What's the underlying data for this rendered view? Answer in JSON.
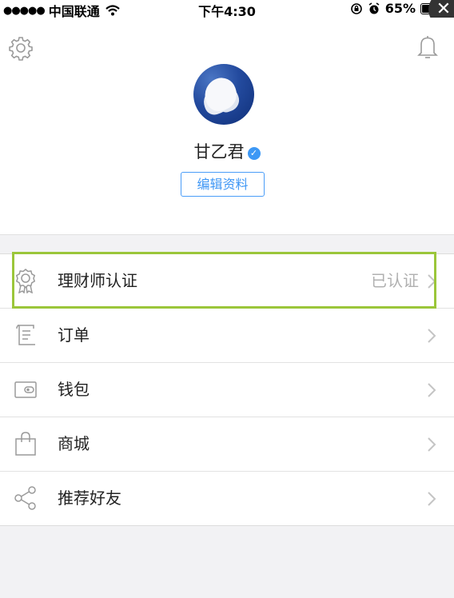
{
  "status_bar": {
    "signal_dots": "●●●●●",
    "carrier": "中国联通",
    "time": "下午4:30",
    "battery": "65%",
    "battery_level": 0.65,
    "close_glyph": "✕"
  },
  "profile": {
    "name": "甘乙君",
    "edit_label": "编辑资料",
    "icons": [
      "gear-icon",
      "bell-icon",
      "verified-icon"
    ]
  },
  "menu": {
    "items": [
      {
        "label": "理财师认证",
        "value": "已认证",
        "icon": "award-icon"
      },
      {
        "label": "订单",
        "value": "",
        "icon": "receipt-icon"
      },
      {
        "label": "钱包",
        "value": "",
        "icon": "wallet-icon"
      },
      {
        "label": "商城",
        "value": "",
        "icon": "shopping-bag-icon"
      },
      {
        "label": "推荐好友",
        "value": "",
        "icon": "share-icon"
      }
    ]
  },
  "colors": {
    "accent": "#3f97f5",
    "highlight": "#9bc63a",
    "background": "#f2f2f4"
  }
}
